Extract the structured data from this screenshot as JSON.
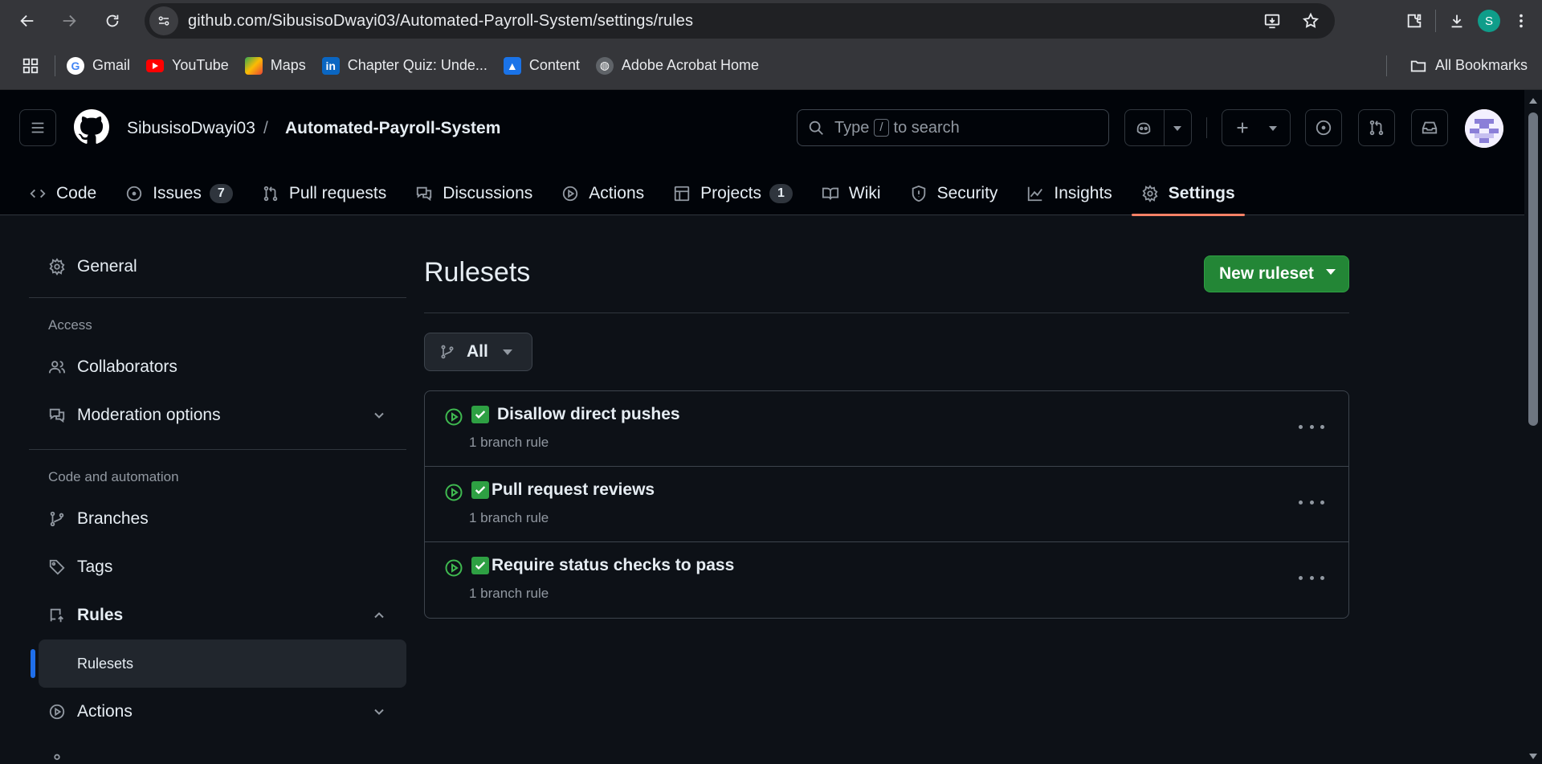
{
  "browser": {
    "url": "github.com/SibusisoDwayi03/Automated-Payroll-System/settings/rules",
    "profile_initial": "S",
    "bookmarks": [
      {
        "label": "Gmail",
        "icon": "gmail-icon"
      },
      {
        "label": "YouTube",
        "icon": "youtube-icon"
      },
      {
        "label": "Maps",
        "icon": "maps-icon"
      },
      {
        "label": "Chapter Quiz: Unde...",
        "icon": "linkedin-icon"
      },
      {
        "label": "Content",
        "icon": "content-icon"
      },
      {
        "label": "Adobe Acrobat Home",
        "icon": "globe-icon"
      }
    ],
    "all_bookmarks": "All Bookmarks"
  },
  "header": {
    "owner": "SibusisoDwayi03",
    "separator": "/",
    "repo": "Automated-Payroll-System",
    "search_prefix": "Type",
    "search_key": "/",
    "search_suffix": "to search"
  },
  "repo_nav": {
    "tabs": [
      {
        "label": "Code",
        "icon": "code-icon"
      },
      {
        "label": "Issues",
        "icon": "issue-icon",
        "count": "7"
      },
      {
        "label": "Pull requests",
        "icon": "pull-request-icon"
      },
      {
        "label": "Discussions",
        "icon": "discussions-icon"
      },
      {
        "label": "Actions",
        "icon": "play-icon"
      },
      {
        "label": "Projects",
        "icon": "table-icon",
        "count": "1"
      },
      {
        "label": "Wiki",
        "icon": "book-icon"
      },
      {
        "label": "Security",
        "icon": "shield-icon"
      },
      {
        "label": "Insights",
        "icon": "graph-icon"
      },
      {
        "label": "Settings",
        "icon": "gear-icon",
        "active": true
      }
    ]
  },
  "sidebar": {
    "general": "General",
    "access_heading": "Access",
    "collaborators": "Collaborators",
    "moderation": "Moderation options",
    "code_heading": "Code and automation",
    "branches": "Branches",
    "tags": "Tags",
    "rules": "Rules",
    "rulesets": "Rulesets",
    "actions": "Actions"
  },
  "main": {
    "title": "Rulesets",
    "new_button": "New ruleset",
    "filter_label": "All",
    "rulesets": [
      {
        "name": "Disallow direct pushes",
        "sub": "1 branch rule"
      },
      {
        "name": "Pull request reviews",
        "sub": "1 branch rule"
      },
      {
        "name": "Require status checks to pass",
        "sub": "1 branch rule"
      }
    ]
  },
  "colors": {
    "accent_green": "#238636",
    "active_tab_underline": "#f78166",
    "selected_indicator": "#1f6feb",
    "ruleset_active": "#3fb950"
  }
}
